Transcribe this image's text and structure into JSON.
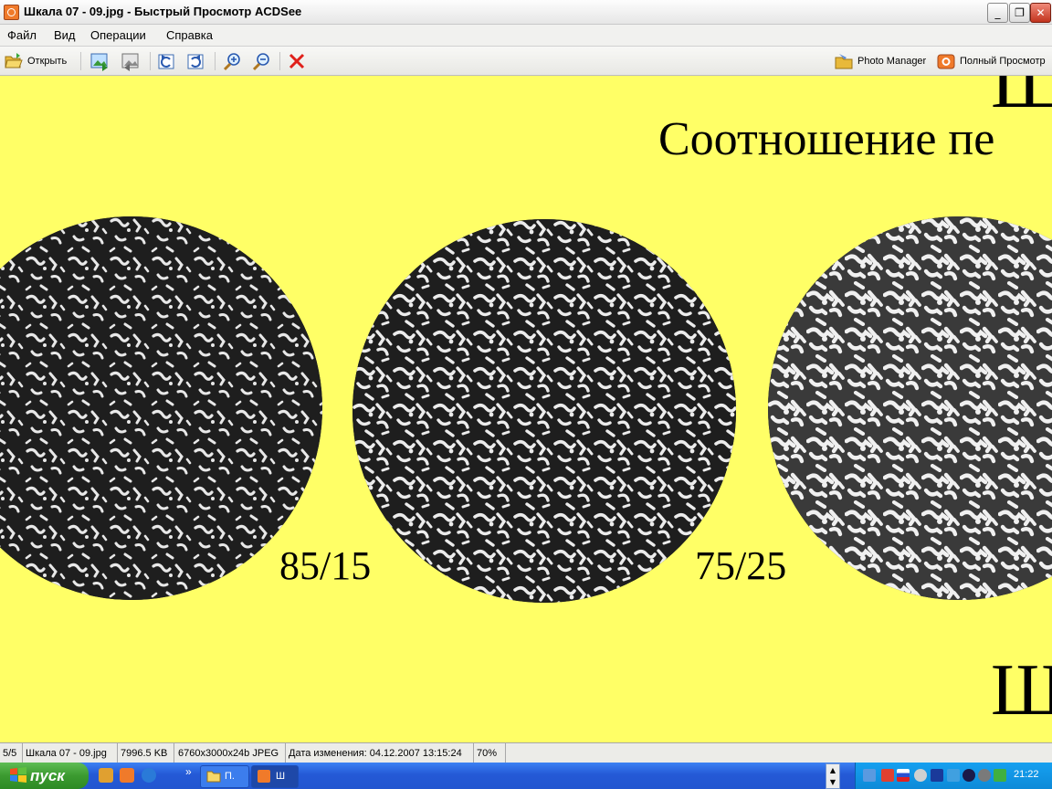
{
  "window": {
    "title": "Шкала 07 - 09.jpg - Быстрый Просмотр ACDSee",
    "controls": {
      "minimize": "_",
      "restore": "❐",
      "close": "✕"
    }
  },
  "menu": [
    "Файл",
    "Вид",
    "Операции",
    "Справка"
  ],
  "toolbar": {
    "open_label": "Открыть",
    "photo_manager_label": "Photo Manager",
    "full_view_label": "Полный Просмотр"
  },
  "image": {
    "heading_text": "Соотношение пе",
    "top_letter": "Ш",
    "bottom_letter": "Ш",
    "ratios": [
      "85/15",
      "75/25"
    ]
  },
  "status": {
    "index": "5/5",
    "filename": "Шкала 07 - 09.jpg",
    "filesize": "7996.5 KB",
    "format": "6760x3000x24b JPEG",
    "modified": "Дата изменения: 04.12.2007 13:15:24",
    "zoom": "70%"
  },
  "taskbar": {
    "start_label": "пуск",
    "chevron": "»",
    "tasks": [
      "П.",
      "Ш"
    ],
    "clock": "21:22"
  }
}
